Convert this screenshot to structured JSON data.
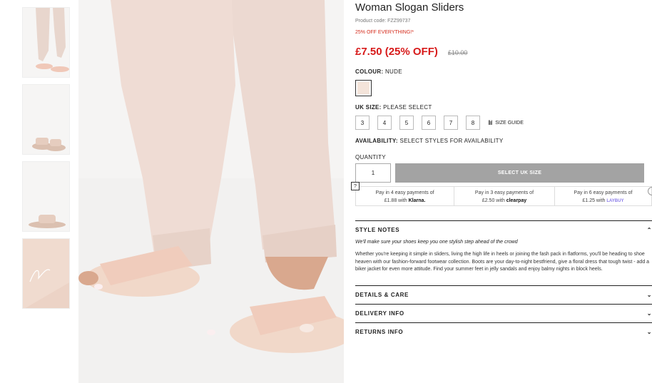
{
  "product": {
    "title": "Woman Slogan Sliders",
    "code": "Product code: FZZ99737",
    "promo": "25% OFF EVERYTHING!*",
    "price": "£7.50 (25% OFF)",
    "was_price": "£10.00"
  },
  "colour": {
    "label": "COLOUR:",
    "value": "NUDE",
    "swatch_color": "#f4e4da"
  },
  "size": {
    "label": "UK SIZE:",
    "value": "PLEASE SELECT",
    "options": [
      "3",
      "4",
      "5",
      "6",
      "7",
      "8"
    ],
    "guide": "SIZE GUIDE",
    "guide_icon": "ruler-icon"
  },
  "availability": {
    "label": "AVAILABILITY:",
    "value": "SELECT STYLES FOR AVAILABILITY"
  },
  "quantity": {
    "label": "QUANTITY",
    "value": "1"
  },
  "cta": {
    "label": "SELECT UK SIZE"
  },
  "payments": [
    {
      "line1": "Pay in 4 easy payments of",
      "amount": "£1.88 with",
      "brand": "Klarna."
    },
    {
      "line1": "Pay in 3 easy payments of",
      "amount": "£2.50 with",
      "brand": "clearpay"
    },
    {
      "line1": "Pay in 6 easy payments of",
      "amount": "£1.25 with",
      "brand": "LAYBUY"
    }
  ],
  "payment_help": "?",
  "accordion": {
    "style_notes": "STYLE NOTES",
    "style_tagline": "We'll make sure your shoes keep you one stylish step ahead of the crowd",
    "style_body": "Whether you're keeping it simple in sliders, living the high life in heels or joining the fash pack in flatforms, you'll be heading to shoe heaven with our fashion-forward footwear collection. Boots are your day-to-night bestfriend, give a floral dress that tough twist - add a biker jacket for even more attitude. Find your summer feet in jelly sandals and enjoy balmy nights in block heels.",
    "details": "DETAILS & CARE",
    "delivery": "DELIVERY INFO",
    "returns": "RETURNS INFO"
  }
}
